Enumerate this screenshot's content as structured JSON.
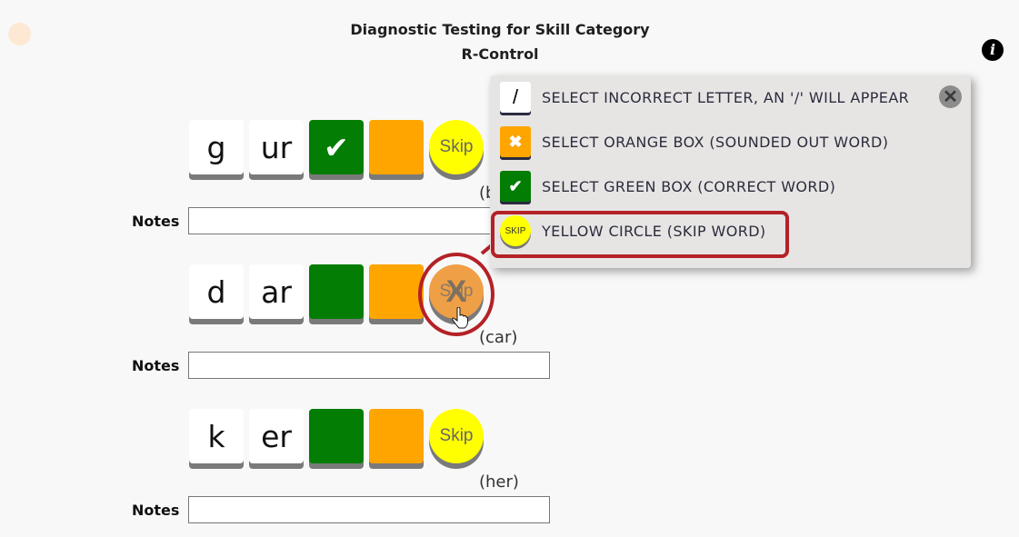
{
  "header": {
    "title": "Diagnostic Testing for Skill Category",
    "subtitle": "R-Control"
  },
  "icons": {
    "info": "i",
    "check": "✔",
    "x": "✖",
    "close": "✕",
    "skip_x": "X"
  },
  "colors": {
    "correct_green": "#037d03",
    "sounded_orange": "#fea500",
    "skip_yellow": "#ffff00",
    "skip_selected_orange": "#ef9f45",
    "highlight_red": "#b42126"
  },
  "notes_label": "Notes",
  "rows": [
    {
      "letters": [
        "g",
        "ur"
      ],
      "green_selected": true,
      "orange_selected": false,
      "skip_selected": false,
      "skip_label": "Skip",
      "pronunciation": "(b",
      "notes_value": ""
    },
    {
      "letters": [
        "d",
        "ar"
      ],
      "green_selected": false,
      "orange_selected": false,
      "skip_selected": true,
      "skip_label": "Skip",
      "pronunciation": "(car)",
      "notes_value": ""
    },
    {
      "letters": [
        "k",
        "er"
      ],
      "green_selected": false,
      "orange_selected": false,
      "skip_selected": false,
      "skip_label": "Skip",
      "pronunciation": "(her)",
      "notes_value": ""
    }
  ],
  "legend_popup": {
    "items": [
      {
        "swatch_text": "/",
        "label": "SELECT INCORRECT LETTER, AN '/' WILL APPEAR"
      },
      {
        "swatch_text": "✖",
        "label": "SELECT ORANGE BOX (SOUNDED OUT WORD)"
      },
      {
        "swatch_text": "✔",
        "label": "SELECT GREEN BOX (CORRECT WORD)"
      },
      {
        "swatch_text": "SKIP",
        "label": "YELLOW CIRCLE (SKIP WORD)"
      }
    ]
  }
}
